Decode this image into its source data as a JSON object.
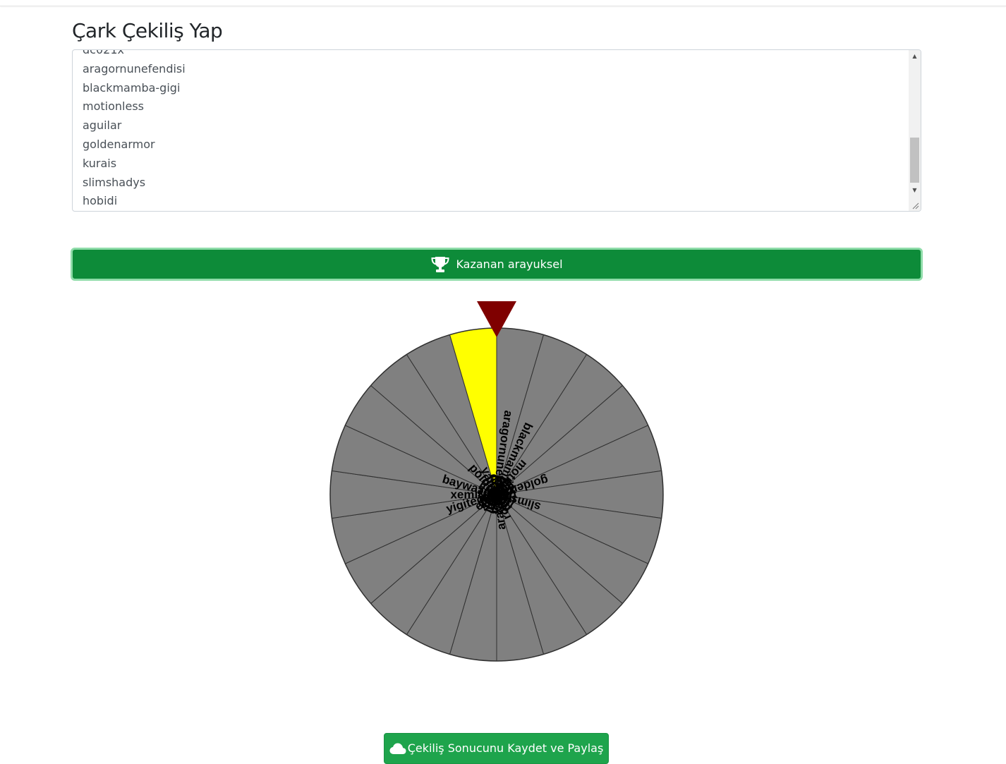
{
  "page": {
    "title": "Çark Çekiliş Yap"
  },
  "participants_visible": [
    "dc021x",
    "aragornunefendisi",
    "blackmamba-gigi",
    "motionless",
    "aguilar",
    "goldenarmor",
    "kurais",
    "slimshadys",
    "hobidi"
  ],
  "winner_button": {
    "label": "Kazanan arayuksel",
    "icon": "trophy-icon"
  },
  "wheel": {
    "segments": [
      "insann",
      "naxlez",
      "468409",
      "efe2506",
      "yigitegecelik",
      "xemirozkan",
      "baywazowski",
      "akari",
      "polorchen",
      "yamaner",
      "dc021x",
      "aragornunefendisi",
      "blackmamba-gigi",
      "motionless",
      "aguilar",
      "goldenarmor",
      "kurais",
      "slimshadys",
      "hobidi",
      "mharin",
      "rosalind",
      "arayuksel"
    ],
    "winner": "arayuksel",
    "colors": {
      "segment": "#808080",
      "winner_segment": "#ffff00",
      "pointer": "#7f0000",
      "stroke": "#303030"
    }
  },
  "save_button": {
    "label": "Çekiliş Sonucunu Kaydet ve Paylaş",
    "icon": "cloud-icon"
  }
}
